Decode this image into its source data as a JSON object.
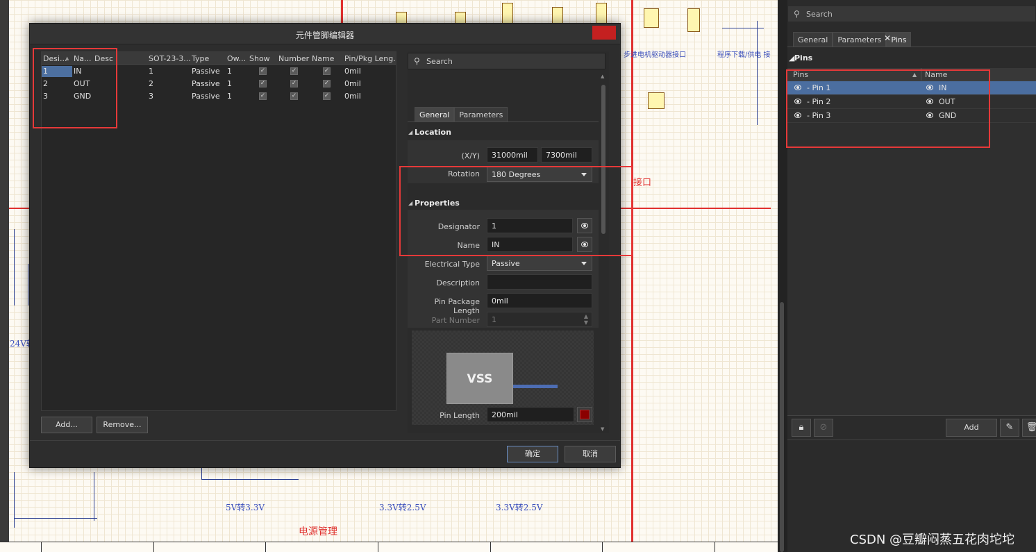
{
  "schematic": {
    "labels_blue": [
      "步进电机驱动器接口",
      "程序下载/供电 接",
      "5V转3.3V",
      "3.3V转2.5V",
      "3.3V转2.5V",
      "24V转"
    ],
    "labels_red": [
      "接口",
      "电源管理"
    ]
  },
  "dialog": {
    "title": "元件管脚编辑器",
    "close_label": "✕",
    "columns": [
      "Desi...",
      "Na...",
      "Desc",
      "SOT-23-3...",
      "Type",
      "Ow...",
      "Show",
      "Number",
      "Name",
      "Pin/Pkg Leng..."
    ],
    "rows": [
      {
        "designator": "1",
        "name": "IN",
        "desc": "",
        "pkg": "1",
        "type": "Passive",
        "owner": "1",
        "show": "✓",
        "number": "✓",
        "name_vis": "✓",
        "pin_len": "0mil"
      },
      {
        "designator": "2",
        "name": "OUT",
        "desc": "",
        "pkg": "2",
        "type": "Passive",
        "owner": "1",
        "show": "✓",
        "number": "✓",
        "name_vis": "✓",
        "pin_len": "0mil"
      },
      {
        "designator": "3",
        "name": "GND",
        "desc": "",
        "pkg": "3",
        "type": "Passive",
        "owner": "1",
        "show": "✓",
        "number": "✓",
        "name_vis": "✓",
        "pin_len": "0mil"
      }
    ],
    "add_label": "Add...",
    "remove_label": "Remove...",
    "ok_label": "确定",
    "cancel_label": "取消",
    "props": {
      "search_placeholder": "Search",
      "tabs": [
        "General",
        "Parameters"
      ],
      "location_header": "Location",
      "xy_label": "(X/Y)",
      "x_value": "31000mil",
      "y_value": "7300mil",
      "rotation_label": "Rotation",
      "rotation_value": "180 Degrees",
      "properties_header": "Properties",
      "designator_label": "Designator",
      "designator_value": "1",
      "name_label": "Name",
      "name_value": "IN",
      "etype_label": "Electrical Type",
      "etype_value": "Passive",
      "description_label": "Description",
      "description_value": "",
      "ppl_label": "Pin Package Length",
      "ppl_value": "0mil",
      "partnum_label": "Part Number",
      "partnum_value": "1",
      "preview_text": "VSS",
      "pin_length_label": "Pin Length",
      "pin_length_value": "200mil",
      "pin_color": "#8b0000"
    }
  },
  "right_panel": {
    "search_placeholder": "Search",
    "tabs": [
      "General",
      "Parameters",
      "Pins"
    ],
    "section": "Pins",
    "col_pins": "Pins",
    "col_name": "Name",
    "rows": [
      {
        "pin": "- Pin 1",
        "name": "IN"
      },
      {
        "pin": "- Pin 2",
        "name": "OUT"
      },
      {
        "pin": "- Pin 3",
        "name": "GND"
      }
    ],
    "add_label": "Add"
  },
  "watermark": "CSDN @豆瓣闷蒸五花肉坨坨",
  "colors": {
    "highlight": "#e63939",
    "selection": "#4b6ea0",
    "close": "#c42020"
  }
}
